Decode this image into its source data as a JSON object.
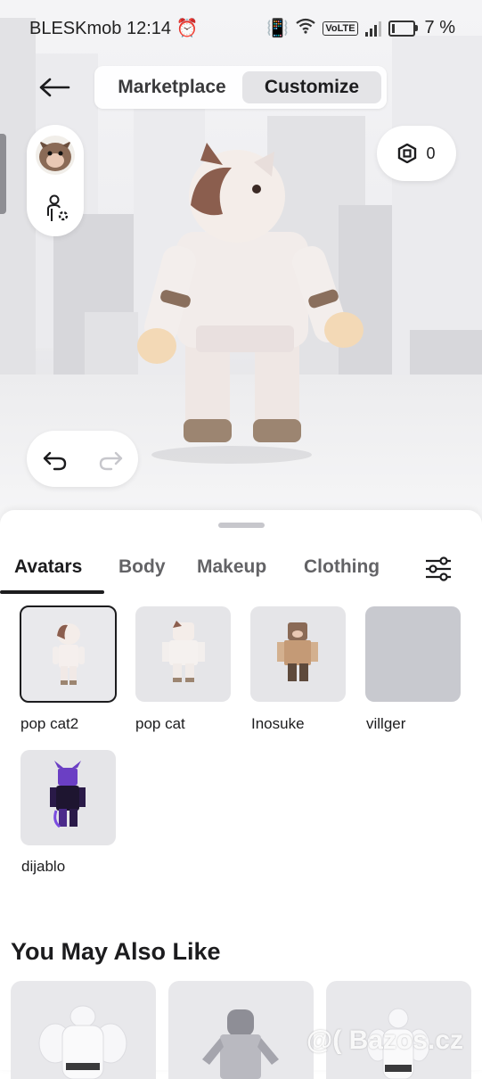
{
  "status_bar": {
    "carrier": "BLESKmob",
    "time": "12:14",
    "volte": "VoLTE",
    "battery": "7 %"
  },
  "header": {
    "tabs": [
      {
        "label": "Marketplace",
        "active": false
      },
      {
        "label": "Customize",
        "active": true
      }
    ]
  },
  "wallet": {
    "robux": "0"
  },
  "categories": [
    {
      "label": "Avatars",
      "active": true
    },
    {
      "label": "Body",
      "active": false
    },
    {
      "label": "Makeup",
      "active": false
    },
    {
      "label": "Clothing",
      "active": false
    }
  ],
  "avatars": [
    {
      "name": "pop cat2",
      "selected": true
    },
    {
      "name": "pop cat",
      "selected": false
    },
    {
      "name": "Inosuke",
      "selected": false
    },
    {
      "name": "villger",
      "selected": false
    },
    {
      "name": "dijablo",
      "selected": false
    }
  ],
  "recommendations": {
    "title": "You May Also Like"
  },
  "watermark": "@( Bazos.cz",
  "colors": {
    "accent": "#1c1c1e",
    "tile_bg": "#e5e5e8",
    "scene_bg": "#ececef"
  }
}
